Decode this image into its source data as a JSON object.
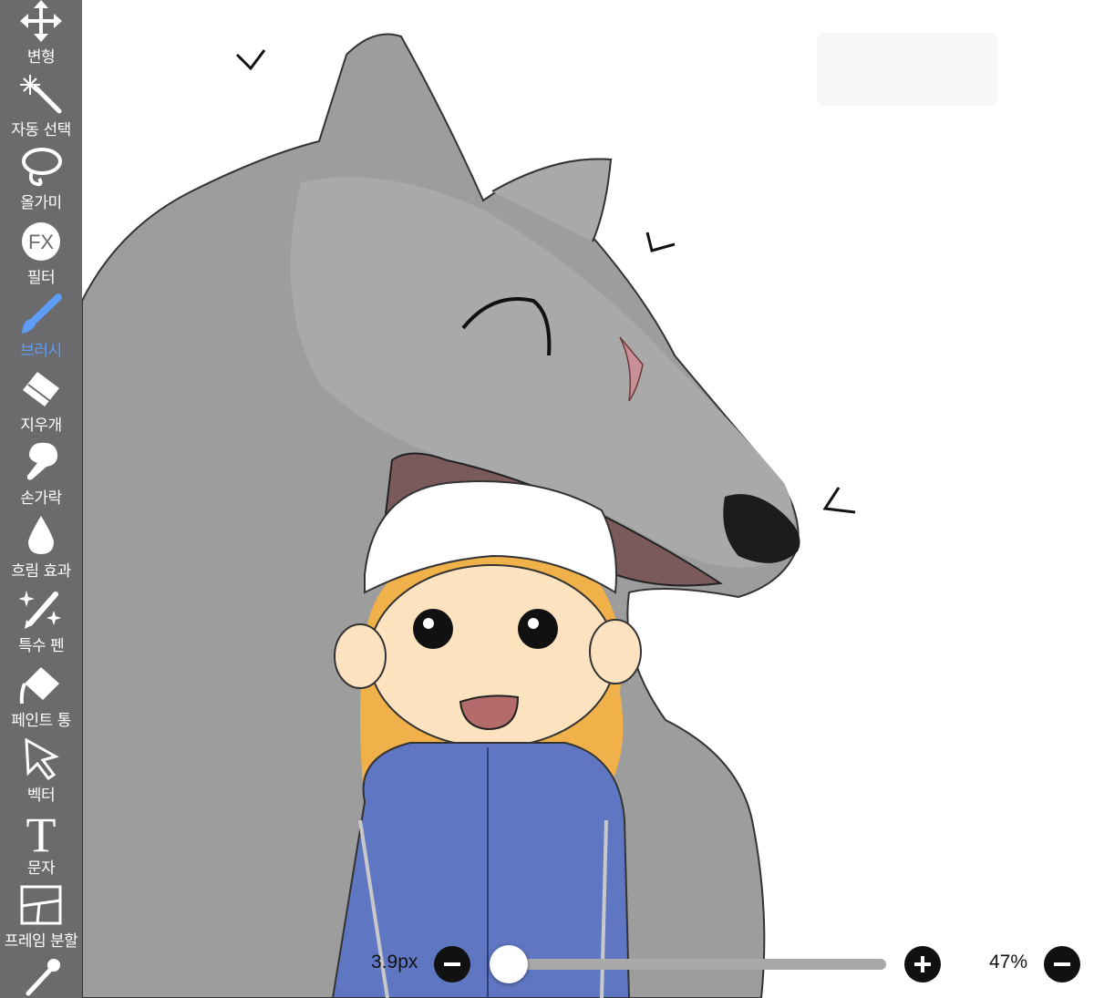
{
  "toolbar": {
    "tools": [
      {
        "label": "변형",
        "icon": "move-icon"
      },
      {
        "label": "자동 선택",
        "icon": "magic-wand-icon"
      },
      {
        "label": "올가미",
        "icon": "lasso-icon"
      },
      {
        "label": "필터",
        "icon": "fx-icon",
        "glyph": "FX"
      },
      {
        "label": "브러시",
        "icon": "brush-icon"
      },
      {
        "label": "지우개",
        "icon": "eraser-icon"
      },
      {
        "label": "손가락",
        "icon": "finger-icon"
      },
      {
        "label": "흐림 효과",
        "icon": "drop-icon"
      },
      {
        "label": "특수 펜",
        "icon": "sparkle-pen-icon"
      },
      {
        "label": "페인트 통",
        "icon": "paint-bucket-icon"
      },
      {
        "label": "벡터",
        "icon": "arrow-cursor-icon"
      },
      {
        "label": "문자",
        "icon": "text-icon",
        "glyph": "T"
      },
      {
        "label": "프레임 분할",
        "icon": "frame-divider-icon"
      }
    ],
    "active_tool": "브러시",
    "active_color": "#5d9cf7"
  },
  "bottom_bar": {
    "brush_size": "3.9px",
    "brush_size_slider_fraction": 0.02,
    "opacity": "47%"
  },
  "canvas": {
    "content": "wolf-and-child-drawing"
  }
}
